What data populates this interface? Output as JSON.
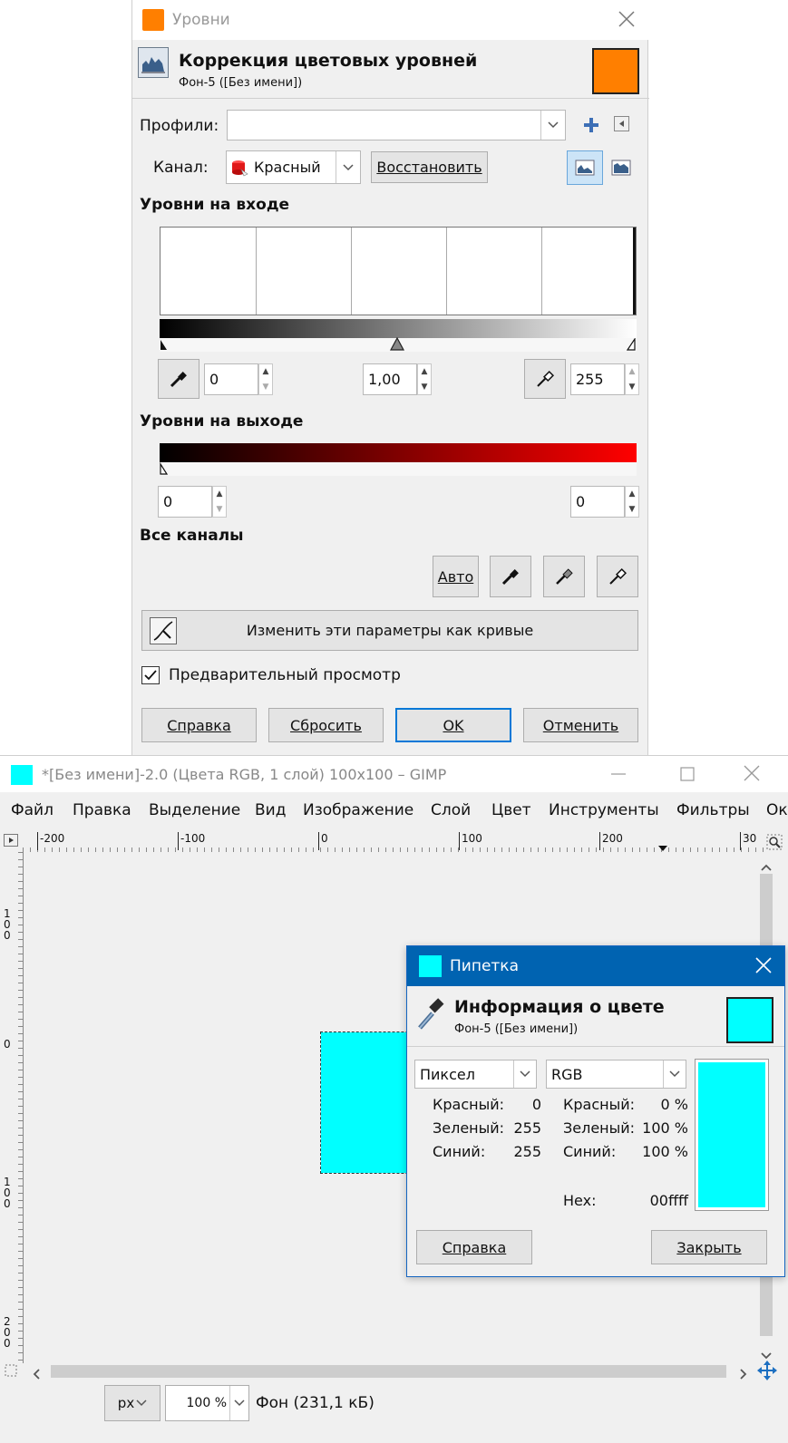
{
  "levels_dialog": {
    "window_title": "Уровни",
    "header_title": "Коррекция цветовых уровней",
    "header_subtitle": "Фон-5 ([Без имени])",
    "accent_color": "#ff7f00",
    "presets_label": "Профили:",
    "presets_value": "",
    "channel_label": "Канал:",
    "channel_value": "Красный",
    "reset_channel_button": "Восстановить",
    "input_levels_title": "Уровни на входе",
    "input_low": "0",
    "input_gamma": "1,00",
    "input_high": "255",
    "output_levels_title": "Уровни на выходе",
    "output_low": "0",
    "output_high": "0",
    "all_channels_title": "Все каналы",
    "auto_button": "Авто",
    "edit_as_curves_button": "Изменить эти параметры как кривые",
    "preview_label": "Предварительный просмотр",
    "preview_checked": true,
    "help_button": "Справка",
    "reset_button": "Сбросить",
    "ok_button": "OK",
    "cancel_button": "Отменить"
  },
  "gimp_window": {
    "title": "*[Без имени]-2.0 (Цвета RGB, 1 слой) 100x100 – GIMP",
    "icon_color": "#00ffff",
    "menu": [
      "Файл",
      "Правка",
      "Выделение",
      "Вид",
      "Изображение",
      "Слой",
      "Цвет",
      "Инструменты",
      "Фильтры",
      "Ок"
    ],
    "ruler_h_labels": [
      "-200",
      "-100",
      "0",
      "100",
      "200",
      "30"
    ],
    "ruler_v_labels": [
      "100",
      "0",
      "100",
      "200"
    ],
    "unit_value": "px",
    "zoom_value": "100 %",
    "status_text": "Фон (231,1 кБ)",
    "canvas_color": "#00ffff"
  },
  "pointer_dialog": {
    "window_title": "Пипетка",
    "header_title": "Информация о цвете",
    "header_subtitle": "Фон-5 ([Без имени])",
    "swatch_color": "#00ffff",
    "mode_left": "Пиксел",
    "mode_right": "RGB",
    "left_values": [
      {
        "label": "Красный:",
        "value": "0"
      },
      {
        "label": "Зеленый:",
        "value": "255"
      },
      {
        "label": "Синий:",
        "value": "255"
      }
    ],
    "right_values": [
      {
        "label": "Красный:",
        "value": "0 %"
      },
      {
        "label": "Зеленый:",
        "value": "100 %"
      },
      {
        "label": "Синий:",
        "value": "100 %"
      }
    ],
    "hex_label": "Hex:",
    "hex_value": "00ffff",
    "help_button": "Справка",
    "close_button": "Закрыть"
  }
}
